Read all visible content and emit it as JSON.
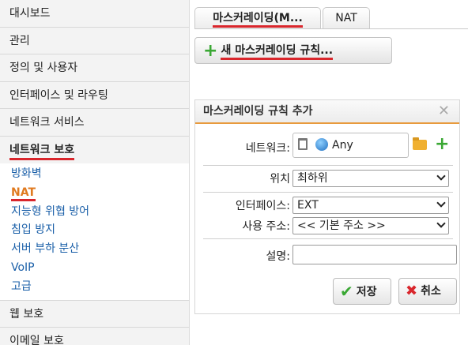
{
  "sidebar": {
    "items_top": [
      "대시보드",
      "관리",
      "정의 및 사용자",
      "인터페이스 및 라우팅",
      "네트워크 서비스"
    ],
    "active_group": "네트워크 보호",
    "sub_items": [
      "방화벽",
      "NAT",
      "지능형 위협 방어",
      "침입 방지",
      "서버 부하 분산",
      "VoIP",
      "고급"
    ],
    "active_sub": "NAT",
    "items_bottom": [
      "웹 보호",
      "이메일 보호"
    ]
  },
  "tabs": [
    "마스커레이딩(M...",
    "NAT"
  ],
  "new_rule_button": "새 마스커레이딩 규칙...",
  "dialog": {
    "title": "마스커레이딩 규칙 추가",
    "close_glyph": "✕",
    "network_label": "네트워크:",
    "network_value": "Any",
    "position_label": "위치",
    "position_value": "최하위",
    "interface_label": "인터페이스:",
    "interface_value": "EXT",
    "address_label": "사용 주소:",
    "address_value": "<< 기본 주소 >>",
    "description_label": "설명:",
    "description_value": "",
    "save_button": "저장",
    "cancel_button": "취소"
  },
  "colors": {
    "accent_underline": "#d9262c",
    "active_sub_item": "#e07a1f",
    "link": "#1a5fa8",
    "add_green": "#3aa834",
    "panel_header_border": "#e89a3c"
  },
  "icons": [
    "plus-icon",
    "trash-icon",
    "globe-icon",
    "folder-icon",
    "close-icon",
    "checkmark-icon",
    "x-icon",
    "chevron-down-icon"
  ]
}
